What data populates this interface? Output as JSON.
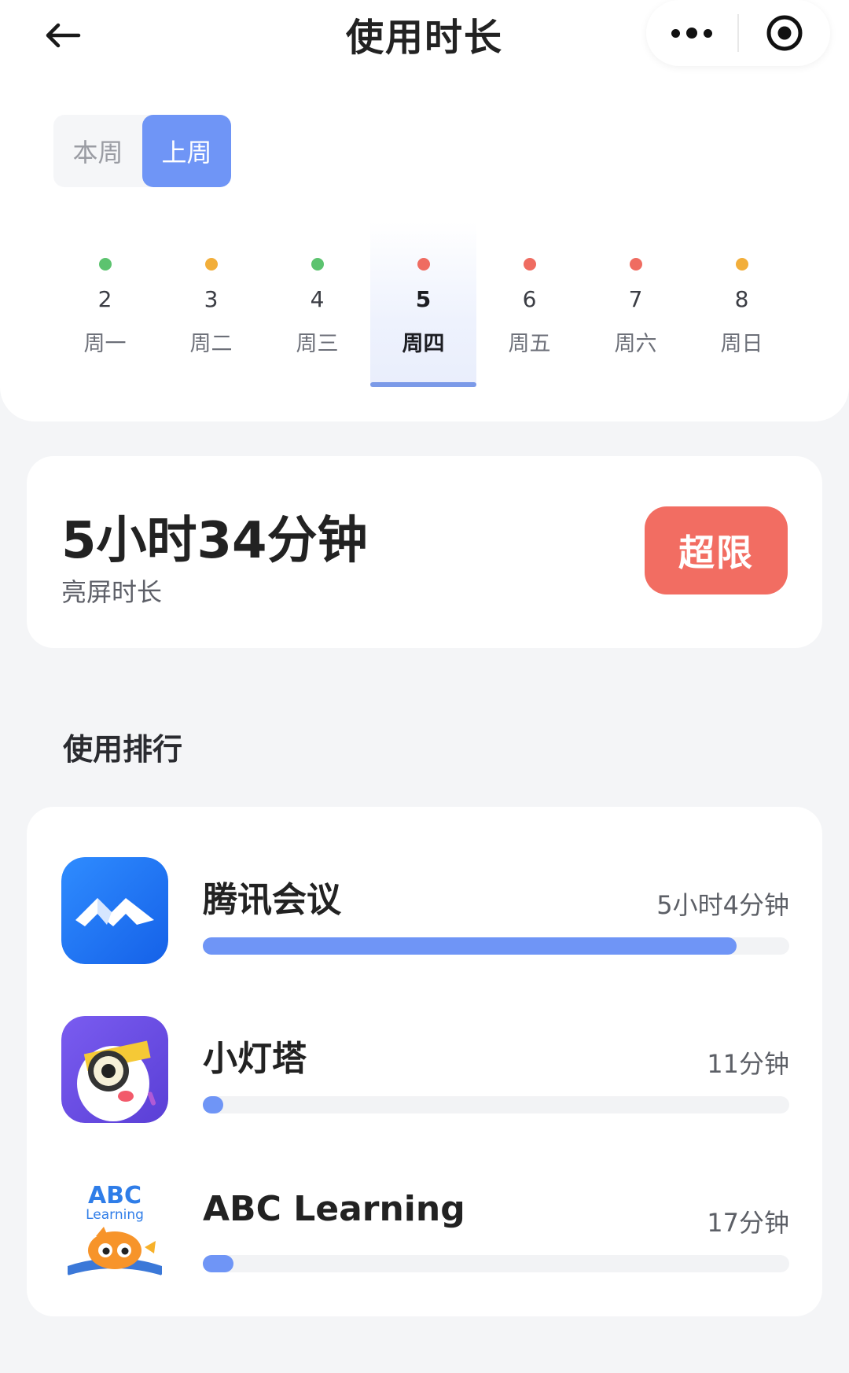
{
  "header": {
    "title": "使用时长",
    "back_icon": "back-arrow-icon",
    "more_icon": "more-dots-icon",
    "close_icon": "target-close-icon"
  },
  "week_toggle": {
    "options": [
      "本周",
      "上周"
    ],
    "selected": "上周"
  },
  "days": [
    {
      "num": "2",
      "name": "周一",
      "status_color": "#5cc36f"
    },
    {
      "num": "3",
      "name": "周二",
      "status_color": "#f2ae3a"
    },
    {
      "num": "4",
      "name": "周三",
      "status_color": "#5cc36f"
    },
    {
      "num": "5",
      "name": "周四",
      "status_color": "#ef6c61"
    },
    {
      "num": "6",
      "name": "周五",
      "status_color": "#ef6c61"
    },
    {
      "num": "7",
      "name": "周六",
      "status_color": "#ef6c61"
    },
    {
      "num": "8",
      "name": "周日",
      "status_color": "#f2ae3a"
    }
  ],
  "selected_day": "5",
  "summary": {
    "total": "5小时34分钟",
    "label": "亮屏时长",
    "badge": "超限",
    "badge_color": "#f26d62"
  },
  "ranking": {
    "title": "使用排行",
    "apps": [
      {
        "name": "腾讯会议",
        "time": "5小时4分钟",
        "progress": 0.91,
        "icon": "tencent-meeting-icon"
      },
      {
        "name": "小灯塔",
        "time": "11分钟",
        "progress": 0.035,
        "icon": "xiaodengta-icon"
      },
      {
        "name": "ABC Learning",
        "time": "17分钟",
        "progress": 0.052,
        "icon": "abc-learning-icon",
        "icon_text": "ABC Learning"
      }
    ]
  },
  "colors": {
    "accent": "#6f95f6",
    "background": "#f4f5f7"
  }
}
